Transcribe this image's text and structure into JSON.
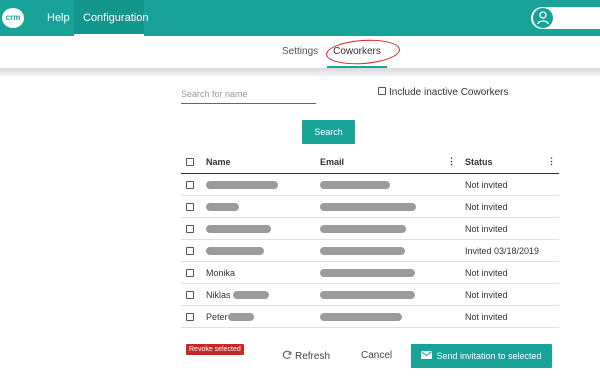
{
  "topbar": {
    "logo_text": "crm",
    "nav": {
      "help": "Help",
      "configuration": "Configuration"
    },
    "accent": "#17a398"
  },
  "subnav": {
    "settings": "Settings",
    "coworkers": "Coworkers"
  },
  "search": {
    "placeholder": "Search for name",
    "include_inactive_label": "Include inactive Coworkers",
    "button": "Search"
  },
  "table": {
    "headers": {
      "name": "Name",
      "email": "Email",
      "status": "Status"
    },
    "rows": [
      {
        "name": "",
        "status": "Not invited"
      },
      {
        "name": "",
        "status": "Not invited"
      },
      {
        "name": "",
        "status": "Not invited"
      },
      {
        "name": "",
        "status": "Invited 03/18/2019"
      },
      {
        "name": "Monika",
        "status": "Not invited"
      },
      {
        "name": "Niklas",
        "status": "Not invited"
      },
      {
        "name": "Peter",
        "status": "Not invited"
      }
    ]
  },
  "footer": {
    "revoke": "Revoke selected",
    "refresh": "Refresh",
    "cancel": "Cancel",
    "send": "Send invitation to selected",
    "danger_color": "#c62828"
  }
}
